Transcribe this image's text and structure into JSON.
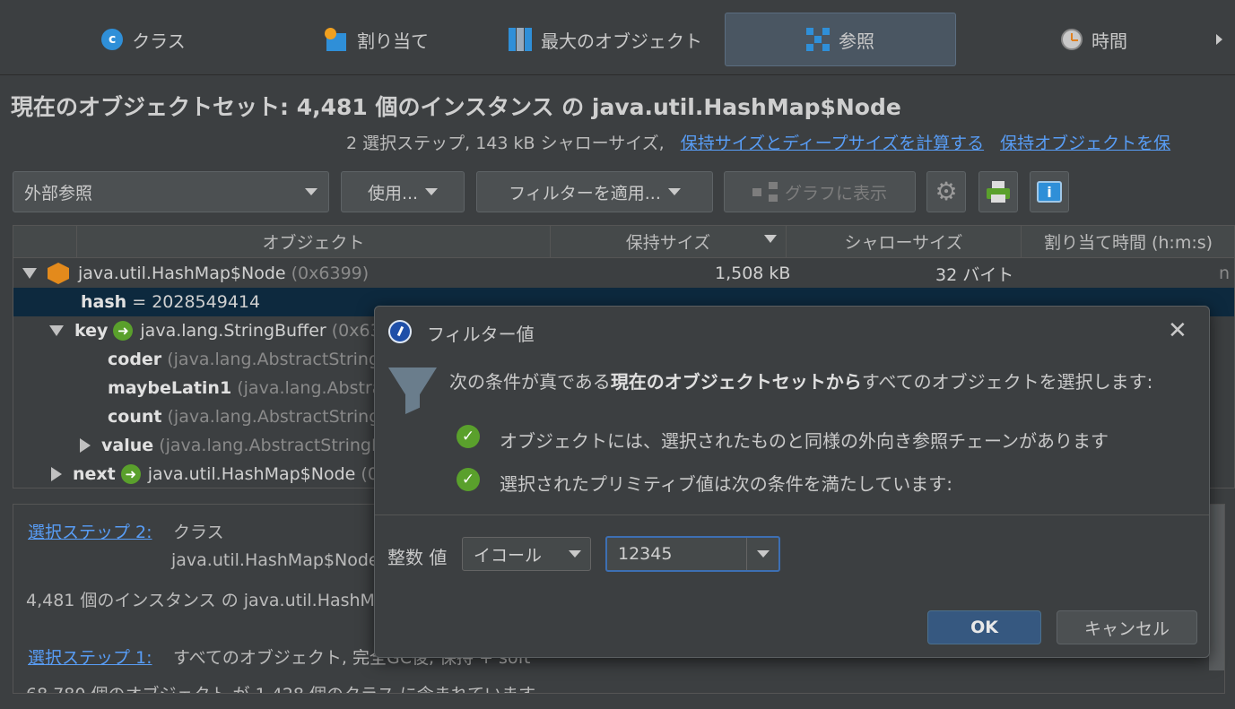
{
  "tabs": [
    {
      "label": "クラス",
      "icon": "class-icon"
    },
    {
      "label": "割り当て",
      "icon": "allocation-icon"
    },
    {
      "label": "最大のオブジェクト",
      "icon": "biggest-objects-icon"
    },
    {
      "label": "参照",
      "icon": "references-icon"
    },
    {
      "label": "時間",
      "icon": "time-icon"
    }
  ],
  "heading": {
    "title": "現在のオブジェクトセット:  4,481 個のインスタンス の java.util.HashMap$Node",
    "summary": "2 選択ステップ, 143 kB シャローサイズ,",
    "link_compute": "保持サイズとディープサイズを計算する",
    "link_retained": "保持オブジェクトを保"
  },
  "toolbar": {
    "view_select": "外部参照",
    "use_label": "使用...",
    "filter_label": "フィルターを適用...",
    "graph_label": "グラフに表示"
  },
  "table": {
    "columns": [
      "オブジェクト",
      "保持サイズ",
      "シャローサイズ",
      "割り当て時間 (h:m:s)"
    ],
    "root": {
      "name": "java.util.HashMap$Node",
      "id": "(0x6399)",
      "retained": "1,508 kB",
      "shallow": "32 バイト",
      "time": "n"
    },
    "hash": {
      "name": "hash",
      "value": "= 2028549414"
    },
    "key": {
      "name": "key",
      "type": "java.lang.StringBuffer",
      "id": "(0x639"
    },
    "key_children": [
      {
        "name": "coder",
        "type": "(java.lang.AbstractStringB"
      },
      {
        "name": "maybeLatin1",
        "type": "(java.lang.Abstrac"
      },
      {
        "name": "count",
        "type": "(java.lang.AbstractStringB"
      }
    ],
    "value_row": {
      "name": "value",
      "type": "(java.lang.AbstractStringBu"
    },
    "next_row": {
      "name": "next",
      "type": "java.util.HashMap$Node",
      "id": "(0x"
    }
  },
  "info": {
    "step2_link": "選択ステップ 2:",
    "step2_text": "クラス",
    "step2_class": "java.util.HashMap$Node",
    "instances": "4,481 個のインスタンス の java.util.HashM",
    "step1_link": "選択ステップ 1:",
    "step1_text": "すべてのオブジェクト, 完全GC後, 保持 + soft",
    "objects": "68,780 個のオブジェクト が 1,428 個のクラス に含まれています"
  },
  "dialog": {
    "title": "フィルター値",
    "intro_prefix": "次の条件が真である",
    "intro_bold": "現在のオブジェクトセットから",
    "intro_suffix": "すべてのオブジェクトを選択します:",
    "cond1": "オブジェクトには、選択されたものと同様の外向き参照チェーンがあります",
    "cond2": "選択されたプリミティブ値は次の条件を満たしています:",
    "field_label": "整数 値",
    "operator": "イコール",
    "value": "12345",
    "ok_label": "OK",
    "cancel_label": "キャンセル"
  },
  "colors": {
    "accent": "#589df6",
    "selection": "#0d293e",
    "check": "#5aa02c"
  }
}
